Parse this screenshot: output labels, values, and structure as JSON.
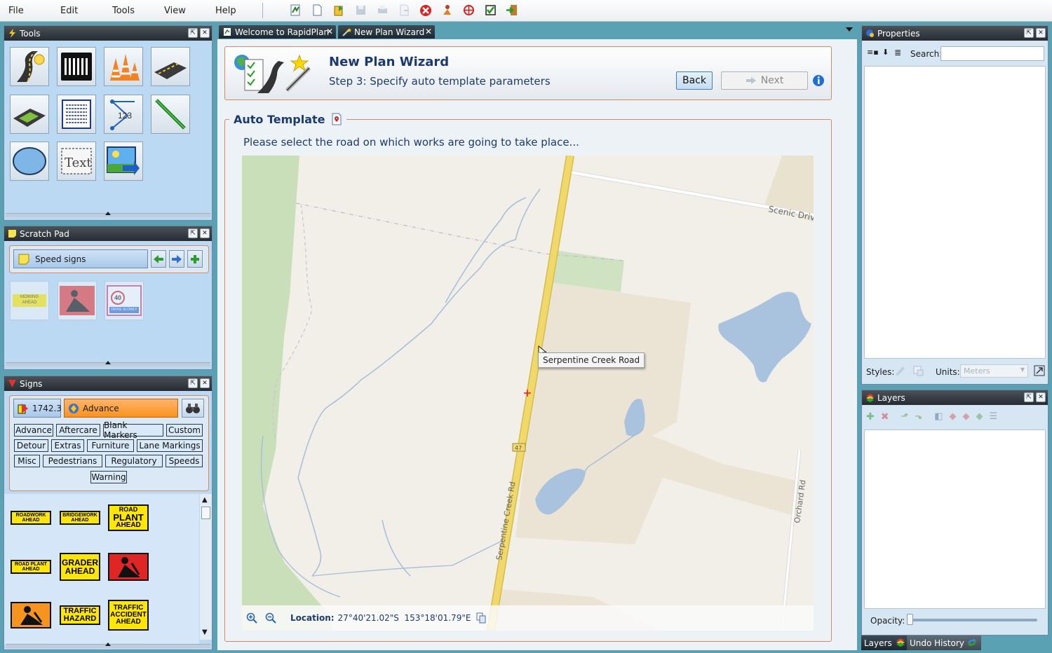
{
  "menu": {
    "file": "File",
    "edit": "Edit",
    "tools": "Tools",
    "view": "View",
    "help": "Help"
  },
  "toolbar": [
    "new-plan-icon",
    "blank-page-icon",
    "open-icon",
    "save-icon",
    "print-icon",
    "export-icon",
    "close-red-icon",
    "worker-icon",
    "target-icon",
    "checkbox-icon",
    "exit-icon"
  ],
  "tools_panel": {
    "title": "Tools"
  },
  "scratch_pad": {
    "title": "Scratch Pad",
    "dropdown": "Speed signs",
    "thumbs": [
      {
        "line1": "MOWING",
        "line2": "AHEAD"
      },
      {
        "line1": "",
        "line2": ""
      },
      {
        "line1": "40",
        "line2": "DRIVE SLOWLY"
      }
    ]
  },
  "signs_panel": {
    "title": "Signs",
    "standard": "1742.3",
    "category": "Advance",
    "categories": [
      "Advance",
      "Aftercare",
      "Blank Markers",
      "Custom",
      "Detour",
      "Extras",
      "Furniture",
      "Lane Markings",
      "Misc",
      "Pedestrians",
      "Regulatory",
      "Speeds",
      "Warning"
    ],
    "signs": [
      {
        "lines": [
          "ROADWORK",
          "AHEAD"
        ]
      },
      {
        "lines": [
          "BRIDGEWORK",
          "AHEAD"
        ]
      },
      {
        "lines": [
          "ROAD",
          "PLANT",
          "AHEAD"
        ]
      },
      {
        "lines": [
          "ROAD PLANT",
          "AHEAD"
        ]
      },
      {
        "lines": [
          "GRADER",
          "AHEAD"
        ]
      },
      {
        "lines": [
          "TRAFFIC",
          "HAZARD"
        ]
      },
      {
        "lines": [
          "TRAFFIC",
          "ACCIDENT",
          "AHEAD"
        ]
      }
    ]
  },
  "tabs": {
    "welcome": "Welcome to RapidPlan",
    "wizard": "New Plan Wizard"
  },
  "wizard": {
    "title": "New Plan Wizard",
    "step": "Step 3: Specify auto template parameters",
    "back": "Back",
    "next": "Next",
    "group_title": "Auto Template",
    "instruction": "Please select the road on which works are going to take place..."
  },
  "map": {
    "road_tooltip": "Serpentine Creek Road",
    "labels": {
      "scenic": "Scenic Drive",
      "serpentine": "Serpentine Creek Rd",
      "orchard": "Orchard Rd",
      "route": "47"
    },
    "location_label": "Location:",
    "location_value": "27°40'21.02\"S  153°18'01.79\"E"
  },
  "properties": {
    "title": "Properties",
    "search_label": "Search:",
    "search_value": "",
    "styles_label": "Styles:",
    "units_label": "Units:",
    "units_value": "Meters"
  },
  "layers": {
    "title": "Layers",
    "opacity_label": "Opacity:",
    "opacity": 0
  },
  "bottom_tabs": {
    "layers": "Layers",
    "undo": "Undo History"
  },
  "colors": {
    "accent": "#d38a67",
    "panel": "#bcd9f4",
    "title_bar": "#262c31",
    "sign_yellow": "#ffe600",
    "sign_orange": "#f7941d",
    "road": "#f0d96a"
  }
}
